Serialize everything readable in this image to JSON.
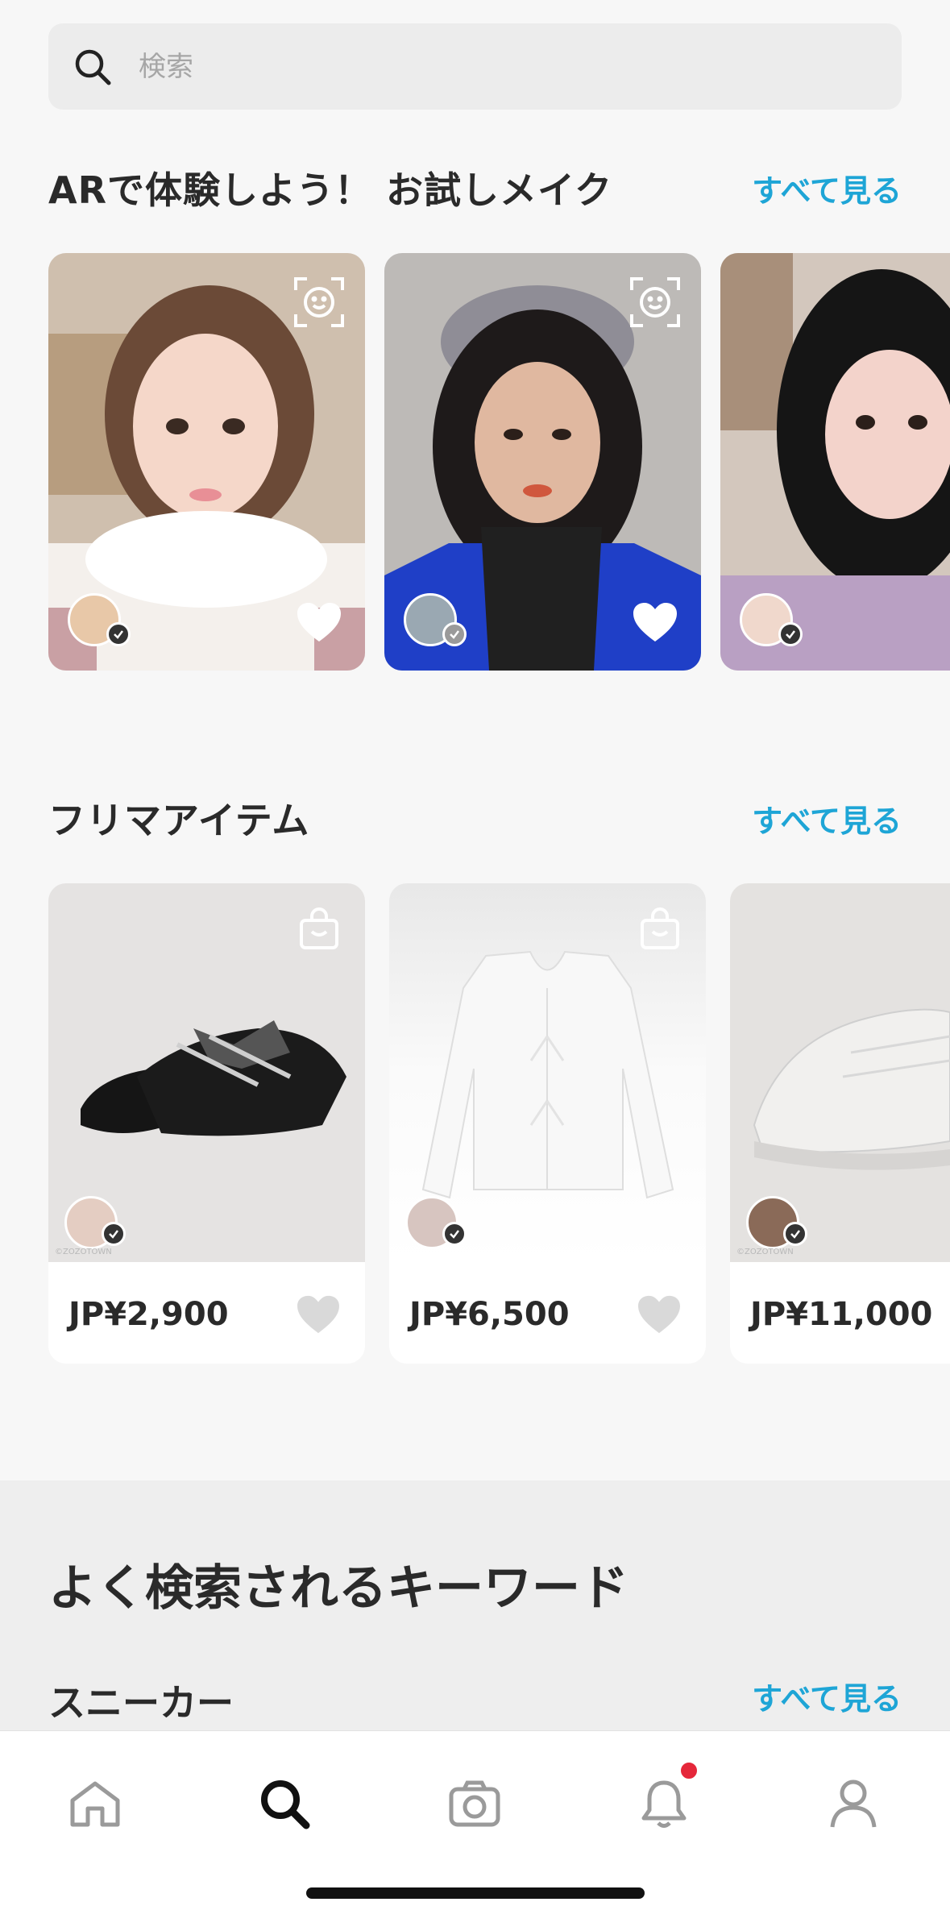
{
  "search": {
    "placeholder": "検索"
  },
  "ar_section": {
    "title": "ARで体験しよう！ お試しメイク",
    "see_all": "すべて見る",
    "cards": [
      {
        "name": "ar-card-1"
      },
      {
        "name": "ar-card-2"
      },
      {
        "name": "ar-card-3"
      }
    ]
  },
  "fleamarket_section": {
    "title": "フリマアイテム",
    "see_all": "すべて見る",
    "items": [
      {
        "price": "JP¥2,900",
        "watermark": "©ZOZOTOWN"
      },
      {
        "price": "JP¥6,500",
        "watermark": ""
      },
      {
        "price": "JP¥11,000",
        "watermark": "©ZOZOTOWN"
      }
    ]
  },
  "keywords_section": {
    "title": "よく検索されるキーワード",
    "sub_title": "スニーカー",
    "see_all": "すべて見る"
  },
  "tabbar": {
    "items": [
      {
        "icon": "home-icon"
      },
      {
        "icon": "search-icon",
        "active": true
      },
      {
        "icon": "camera-icon"
      },
      {
        "icon": "bell-icon",
        "badge": true
      },
      {
        "icon": "profile-icon"
      }
    ]
  },
  "colors": {
    "accent": "#1ea5d6",
    "badge": "#e5273a",
    "background": "#f7f7f7"
  }
}
